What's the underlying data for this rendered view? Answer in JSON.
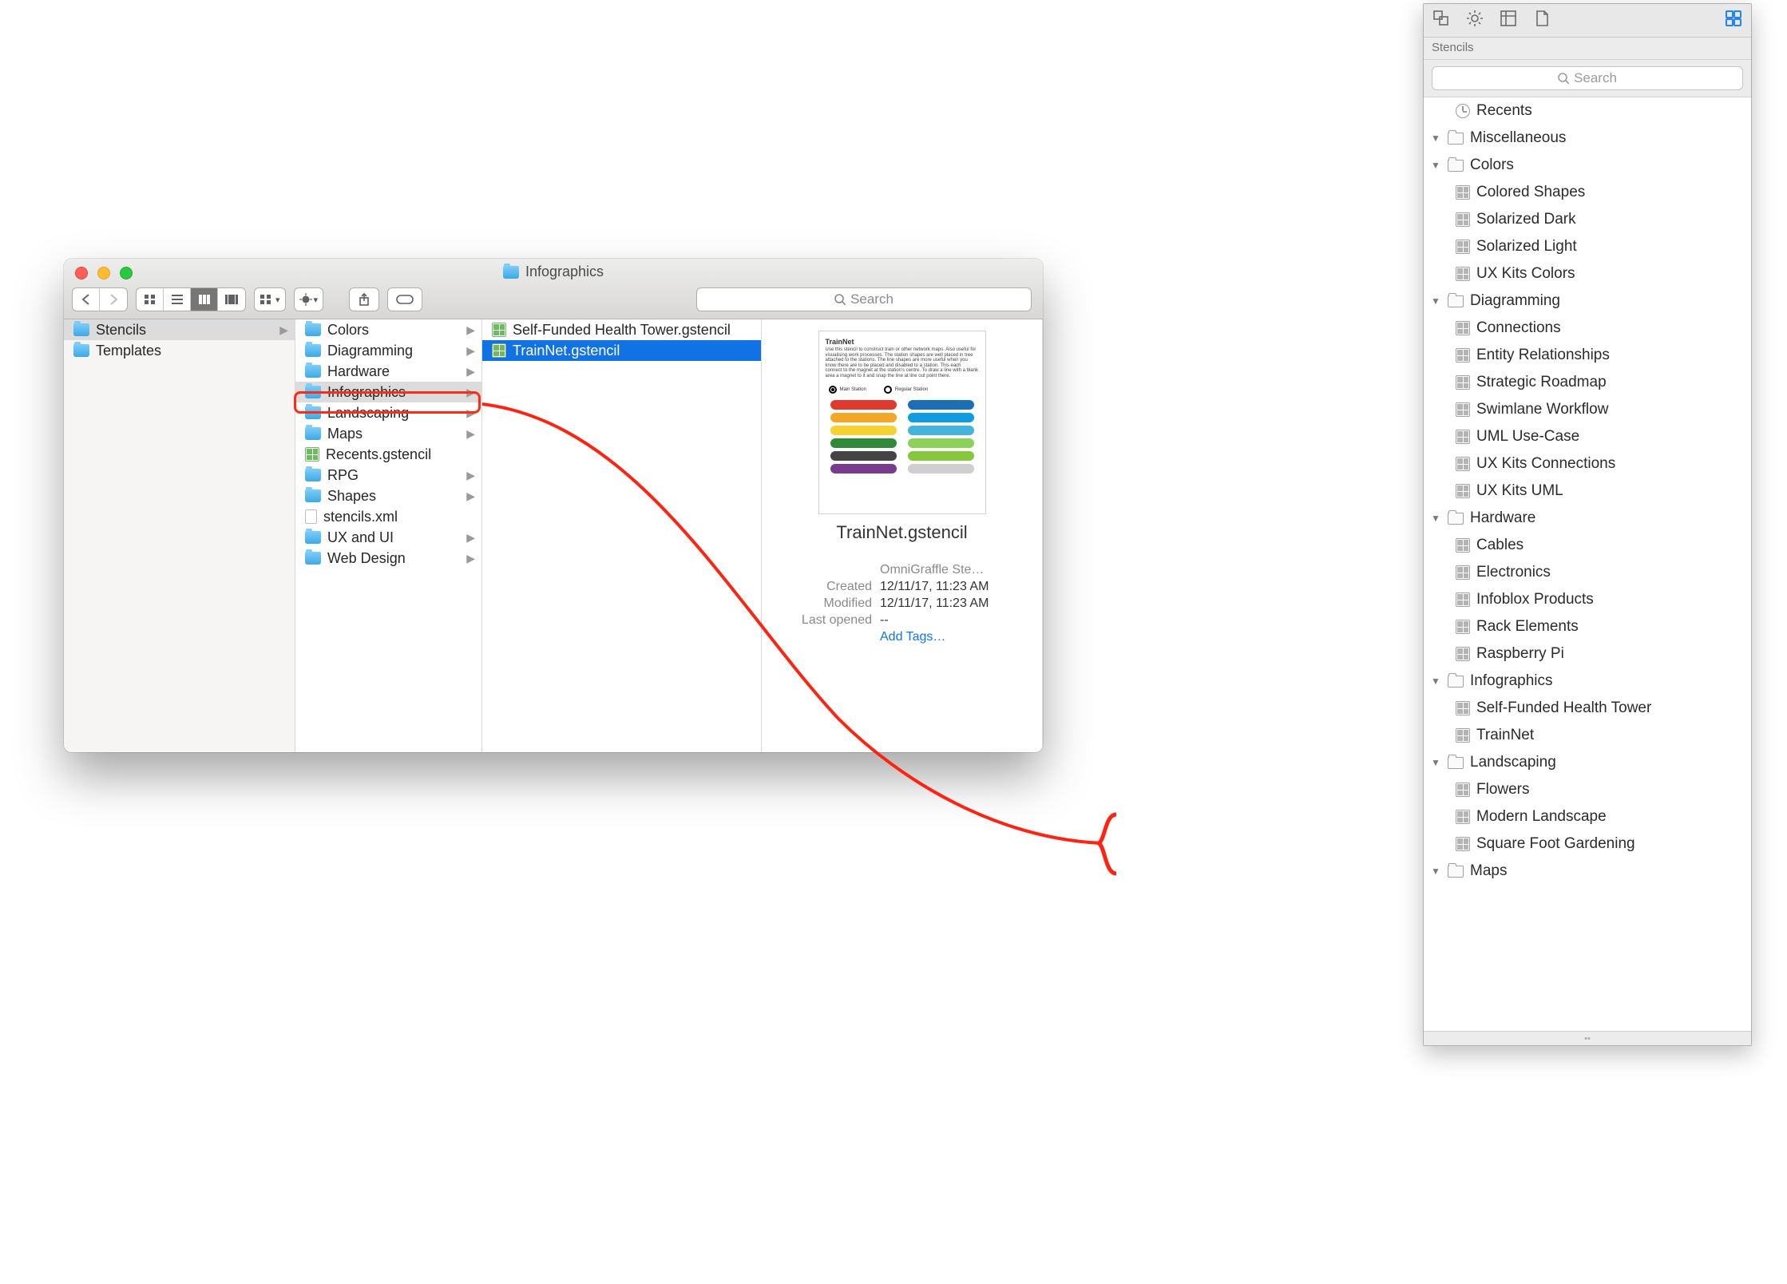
{
  "finder": {
    "title": "Infographics",
    "search_placeholder": "Search",
    "col0": [
      {
        "label": "Stencils",
        "type": "folder",
        "selected": true,
        "hasChildren": true
      },
      {
        "label": "Templates",
        "type": "folder",
        "selected": false,
        "hasChildren": false
      }
    ],
    "col1": [
      {
        "label": "Colors",
        "type": "folder",
        "hasChildren": true
      },
      {
        "label": "Diagramming",
        "type": "folder",
        "hasChildren": true
      },
      {
        "label": "Hardware",
        "type": "folder",
        "hasChildren": true
      },
      {
        "label": "Infographics",
        "type": "folder",
        "hasChildren": true,
        "selected": true
      },
      {
        "label": "Landscaping",
        "type": "folder",
        "hasChildren": true
      },
      {
        "label": "Maps",
        "type": "folder",
        "hasChildren": true
      },
      {
        "label": "Recents.gstencil",
        "type": "stencil"
      },
      {
        "label": "RPG",
        "type": "folder",
        "hasChildren": true
      },
      {
        "label": "Shapes",
        "type": "folder",
        "hasChildren": true
      },
      {
        "label": "stencils.xml",
        "type": "file"
      },
      {
        "label": "UX and UI",
        "type": "folder",
        "hasChildren": true
      },
      {
        "label": "Web Design",
        "type": "folder",
        "hasChildren": true
      }
    ],
    "col2": [
      {
        "label": "Self-Funded Health Tower.gstencil",
        "type": "stencil"
      },
      {
        "label": "TrainNet.gstencil",
        "type": "stencil",
        "hot": true
      }
    ],
    "preview": {
      "thumb_title": "TrainNet",
      "thumb_desc": "Use this stencil to construct train or other network maps. Also useful for visualising work processes. The station shapes are well placed in tree attached to the stations. The line shapes are more useful when you know there are to be placed and disabled to a station. This each connect to the magnet at the station's centre. To draw a line with a blank area a magnet to it and snap the line at line out point there.",
      "dot_main": "Main Station",
      "dot_reg": "Regular Station",
      "swatches": [
        "#e03a2e",
        "#1b6fb5",
        "#f3a727",
        "#0e9de0",
        "#f5d22f",
        "#45b4dd",
        "#2f8a3a",
        "#8bd15a",
        "#444444",
        "#87c73e",
        "#7a3b8f",
        "#cfcfcf"
      ],
      "file_name": "TrainNet.gstencil",
      "kind": "OmniGraffle Ste…",
      "created_k": "Created",
      "created_v": "12/11/17, 11:23 AM",
      "modified_k": "Modified",
      "modified_v": "12/11/17, 11:23 AM",
      "opened_k": "Last opened",
      "opened_v": "--",
      "add_tags": "Add Tags…"
    }
  },
  "panel": {
    "label": "Stencils",
    "search_placeholder": "Search",
    "tree": [
      {
        "d": 2,
        "type": "recents",
        "label": "Recents"
      },
      {
        "d": 1,
        "type": "folder",
        "label": "Miscellaneous",
        "disc": true
      },
      {
        "d": 1,
        "type": "folder",
        "label": "Colors",
        "disc": true
      },
      {
        "d": 2,
        "type": "stencil",
        "label": "Colored Shapes"
      },
      {
        "d": 2,
        "type": "stencil",
        "label": "Solarized Dark"
      },
      {
        "d": 2,
        "type": "stencil",
        "label": "Solarized Light"
      },
      {
        "d": 2,
        "type": "stencil",
        "label": "UX Kits Colors"
      },
      {
        "d": 1,
        "type": "folder",
        "label": "Diagramming",
        "disc": true
      },
      {
        "d": 2,
        "type": "stencil",
        "label": "Connections"
      },
      {
        "d": 2,
        "type": "stencil",
        "label": "Entity Relationships"
      },
      {
        "d": 2,
        "type": "stencil",
        "label": "Strategic Roadmap"
      },
      {
        "d": 2,
        "type": "stencil",
        "label": "Swimlane Workflow"
      },
      {
        "d": 2,
        "type": "stencil",
        "label": "UML Use-Case"
      },
      {
        "d": 2,
        "type": "stencil",
        "label": "UX Kits Connections"
      },
      {
        "d": 2,
        "type": "stencil",
        "label": "UX Kits UML"
      },
      {
        "d": 1,
        "type": "folder",
        "label": "Hardware",
        "disc": true
      },
      {
        "d": 2,
        "type": "stencil",
        "label": "Cables"
      },
      {
        "d": 2,
        "type": "stencil",
        "label": "Electronics"
      },
      {
        "d": 2,
        "type": "stencil",
        "label": "Infoblox Products"
      },
      {
        "d": 2,
        "type": "stencil",
        "label": "Rack Elements"
      },
      {
        "d": 2,
        "type": "stencil",
        "label": "Raspberry Pi"
      },
      {
        "d": 1,
        "type": "folder",
        "label": "Infographics",
        "disc": true
      },
      {
        "d": 2,
        "type": "stencil",
        "label": "Self-Funded Health Tower"
      },
      {
        "d": 2,
        "type": "stencil",
        "label": "TrainNet"
      },
      {
        "d": 1,
        "type": "folder",
        "label": "Landscaping",
        "disc": true
      },
      {
        "d": 2,
        "type": "stencil",
        "label": "Flowers"
      },
      {
        "d": 2,
        "type": "stencil",
        "label": "Modern Landscape"
      },
      {
        "d": 2,
        "type": "stencil",
        "label": "Square Foot Gardening"
      },
      {
        "d": 1,
        "type": "folder",
        "label": "Maps",
        "disc": true
      }
    ]
  }
}
